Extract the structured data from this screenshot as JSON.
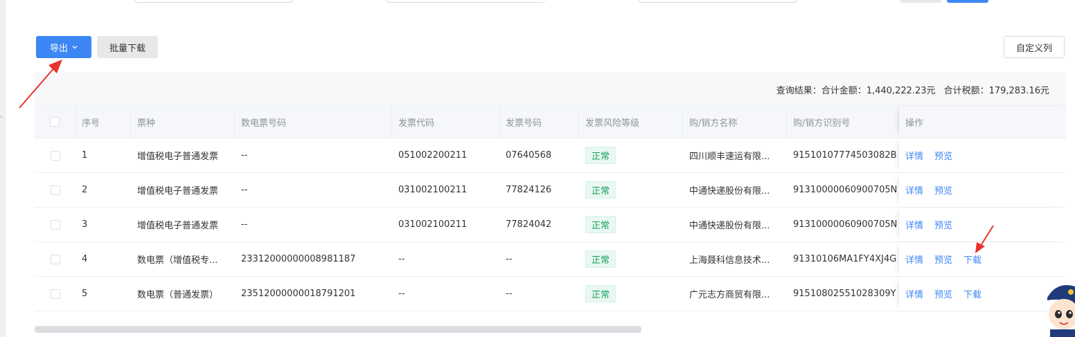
{
  "toolbar": {
    "export_label": "导出",
    "batch_download_label": "批量下载",
    "custom_columns_label": "自定义列"
  },
  "summary": {
    "query_result": "查询结果：合计金额：1,440,222.23元",
    "total_tax": "合计税额：179,283.16元"
  },
  "table": {
    "headers": {
      "index": "序号",
      "ticket_type": "票种",
      "e_invoice_no": "数电票号码",
      "invoice_code": "发票代码",
      "invoice_no": "发票号码",
      "risk_level": "发票风险等级",
      "party_name": "购/销方名称",
      "party_tax_id": "购/销方识别号",
      "actions": "操作"
    },
    "rows": [
      {
        "index": "1",
        "ticket_type": "增值税电子普通发票",
        "e_invoice_no": "--",
        "invoice_code": "051002200211",
        "invoice_no": "07640568",
        "risk_level": "正常",
        "party_name": "四川顺丰速运有限...",
        "party_tax_id": "91510107774503082B",
        "detail": "详情",
        "preview": "预览",
        "download": ""
      },
      {
        "index": "2",
        "ticket_type": "增值税电子普通发票",
        "e_invoice_no": "--",
        "invoice_code": "031002100211",
        "invoice_no": "77824126",
        "risk_level": "正常",
        "party_name": "中通快递股份有限...",
        "party_tax_id": "91310000060900705N",
        "detail": "详情",
        "preview": "预览",
        "download": ""
      },
      {
        "index": "3",
        "ticket_type": "增值税电子普通发票",
        "e_invoice_no": "--",
        "invoice_code": "031002100211",
        "invoice_no": "77824042",
        "risk_level": "正常",
        "party_name": "中通快递股份有限...",
        "party_tax_id": "91310000060900705N",
        "detail": "详情",
        "preview": "预览",
        "download": ""
      },
      {
        "index": "4",
        "ticket_type": "数电票（增值税专...",
        "e_invoice_no": "23312000000008981187",
        "invoice_code": "--",
        "invoice_no": "--",
        "risk_level": "正常",
        "party_name": "上海聂科信息技术...",
        "party_tax_id": "91310106MA1FY4XJ4G",
        "detail": "详情",
        "preview": "预览",
        "download": "下载"
      },
      {
        "index": "5",
        "ticket_type": "数电票（普通发票）",
        "e_invoice_no": "23512000000018791201",
        "invoice_code": "--",
        "invoice_no": "--",
        "risk_level": "正常",
        "party_name": "广元志方商贸有限...",
        "party_tax_id": "91510802551028309Y",
        "detail": "详情",
        "preview": "预览",
        "download": "下载"
      }
    ]
  },
  "colors": {
    "primary": "#3d87f5",
    "tag_green": "#19a05e",
    "annotation_red": "#e8332e"
  }
}
